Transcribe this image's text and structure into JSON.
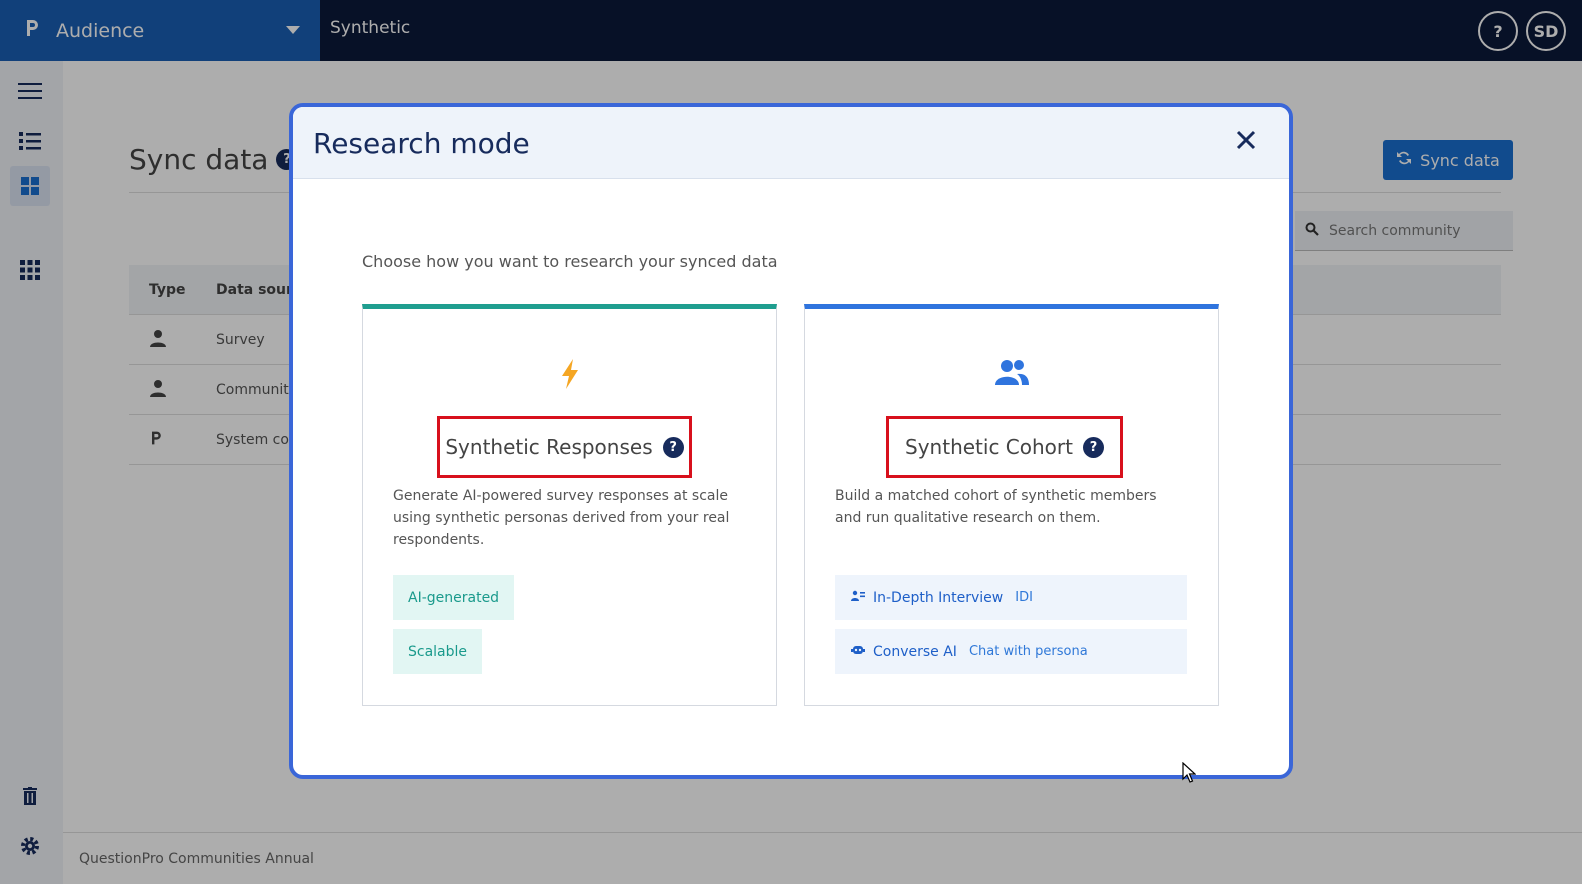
{
  "topbar": {
    "brand": "Audience",
    "app_title": "Synthetic",
    "help_label": "?",
    "avatar_initials": "SD"
  },
  "page": {
    "title": "Sync data",
    "sync_button": "Sync data",
    "search_placeholder": "Search community",
    "table": {
      "headers": [
        "Type",
        "Data sourc"
      ],
      "rows": [
        {
          "type_icon": "person-icon",
          "source": "Survey"
        },
        {
          "type_icon": "person-icon",
          "source": "Communit"
        },
        {
          "type_icon": "questionpro-logo-icon",
          "source": "System co"
        }
      ]
    },
    "footer": "QuestionPro Communities Annual"
  },
  "modal": {
    "title": "Research mode",
    "subtitle": "Choose how you want to research your synced data",
    "cards": [
      {
        "icon": "lightning-icon",
        "title": "Synthetic Responses",
        "description": "Generate AI-powered survey responses at scale using synthetic personas derived from your real respondents.",
        "tags": [
          "AI-generated",
          "Scalable"
        ],
        "accent": "#1f9e8f"
      },
      {
        "icon": "users-icon",
        "title": "Synthetic Cohort",
        "description": "Build a matched cohort of synthetic members and run qualitative research on them.",
        "methods": [
          {
            "label": "In-Depth Interview",
            "sub": "IDI"
          },
          {
            "label": "Converse AI",
            "sub": "Chat with persona"
          }
        ],
        "accent": "#2f74de"
      }
    ]
  },
  "colors": {
    "topbar": "#0b1a3a",
    "brand": "#1a5fb4",
    "modal_border": "#3a66d8",
    "highlight": "#d8101c"
  }
}
